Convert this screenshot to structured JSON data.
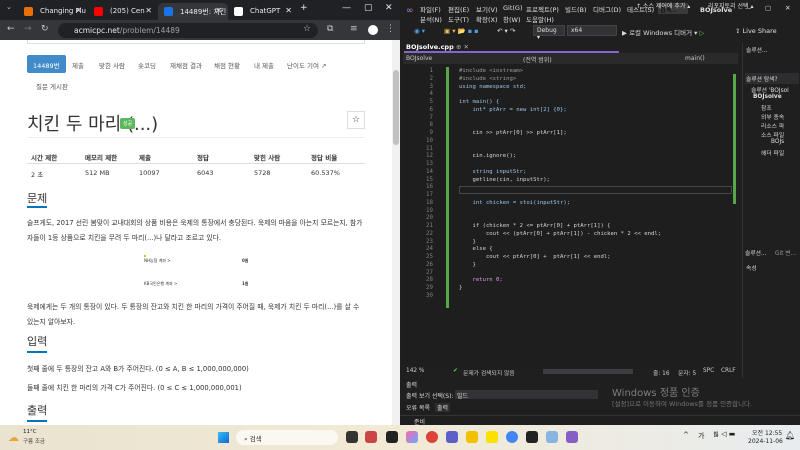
{
  "chrome": {
    "tabs": [
      {
        "label": "Changing Flu",
        "color": "#e8710a"
      },
      {
        "label": "(205) Cen",
        "color": "#ff0000"
      },
      {
        "label": "14489번: 치킨",
        "color": "#1a73e8",
        "active": true
      },
      {
        "label": "ChatGPT",
        "color": "#ffffff"
      }
    ],
    "new_tab": "+",
    "url_host": "acmicpc.net",
    "url_path": "/problem/14489"
  },
  "page": {
    "tabs": [
      "14489번",
      "제출",
      "맞힌 사람",
      "숏코딩",
      "재채점 결과",
      "채점 현황",
      "내 제출",
      "난이도 기여 ↗"
    ],
    "tab_board": "질문 게시판",
    "title": "치킨 두 마리 (...)",
    "badge": "성공",
    "star": "☆",
    "table_headers": [
      "시간 제한",
      "메모리 제한",
      "제출",
      "정답",
      "맞힌 사람",
      "정답 비율"
    ],
    "table_row": [
      "2 초",
      "512 MB",
      "10097",
      "6043",
      "5728",
      "60.537%"
    ],
    "h_problem": "문제",
    "problem_p1": "슬프게도, 2017 선린 봄맞이 교내대회의 상품 비용은 욱제의 통장에서 충당된다. 욱제의 마음을 아는지 모르는지, 참가자들이 1등 상품으로 치킨을 무려 두 마리(...)나 달라고 조르고 있다.",
    "image_rows": [
      {
        "bank": "NH농협 계좌 >",
        "amount": "0원"
      },
      {
        "bank": "KB국민은행 계좌 >",
        "amount": "1원"
      }
    ],
    "problem_p2": "욱제에게는 두 개의 통장이 있다. 두 통장의 잔고와 치킨 한 마리의 가격이 주어질 때, 욱제가 치킨 두 마리(...)를 살 수 있는지 알아보자.",
    "h_input": "입력",
    "input_1": "첫째 줄에 두 통장의 잔고 A와 B가 주어진다. (0 ≤ A, B ≤ 1,000,000,000)",
    "input_2": "둘째 줄에 치킨 한 마리의 가격 C가 주어진다. (0 ≤ C ≤ 1,000,000,001)",
    "h_output": "출력"
  },
  "vs": {
    "menu1": [
      "파일(F)",
      "편집(E)",
      "보기(V)",
      "Git(G)",
      "프로젝트(P)",
      "빌드(B)",
      "디버그(D)",
      "테스트(S)"
    ],
    "menu2": [
      "분석(N)",
      "도구(T)",
      "확장(X)",
      "창(W)",
      "도움말(H)"
    ],
    "search": "검색...",
    "solution_name": "BOJsolve",
    "config": "Debug",
    "platform": "x64",
    "run": "▶ 로컬 Windows 디버거 ▾",
    "live_share": "Live Share",
    "doc_tab": "BOJsolve.cpp",
    "nav_project": "BOJsolve",
    "nav_scope": "(전역 범위)",
    "nav_member": "main()",
    "code": [
      "#include <iostream>",
      "#include <string>",
      "using namespace std;",
      "",
      "int main() {",
      "    int* ptArr = new int[2] {0};",
      "",
      "",
      "    cin >> ptArr[0] >> ptArr[1];",
      "",
      "",
      "    cin.ignore();",
      "",
      "    string inputStr;",
      "    getline(cin, inputStr);",
      "",
      "",
      "    int chicken = stoi(inputStr);",
      "",
      "",
      "    if (chicken * 2 <= ptArr[0] + ptArr[1]) {",
      "        cout << (ptArr[0] + ptArr[1]) - chicken * 2 << endl;",
      "    }",
      "    else {",
      "        cout << ptArr[0] +  ptArr[1] << endl;",
      "    }",
      "",
      "    return 0;",
      "}",
      ""
    ],
    "zoom": "142 %",
    "issues": "문제가 검색되지 않음",
    "line": "줄: 16",
    "col": "문자: 5",
    "spc": "SPC",
    "crlf": "CRLF",
    "solution_explorer": {
      "title": "솔루션...",
      "search": "솔루션 탐색?",
      "items": [
        "솔루션 'BOJsol",
        "BOJsolve",
        "참조",
        "외부 종속",
        "리소스 파",
        "소스 파일",
        "BOJs",
        "헤더 파일"
      ],
      "tabs": [
        "솔루션...",
        "Git 변..."
      ],
      "properties": "속성"
    },
    "output": {
      "title": "출력",
      "label": "출력 보기 선택(S):",
      "value": "빌드",
      "tabs": [
        "오류 목록",
        "출력"
      ]
    },
    "status": {
      "ready": "준비",
      "source_control": "↑ 소스 제어에 추가 ▴",
      "repo": "리포지토리 선택 ▴"
    },
    "watermark": "Windows 정품 인증",
    "watermark_sub": "[설정]으로 이동하여 Windows를 정품 인증합니다."
  },
  "taskbar": {
    "temp": "11°C",
    "weather": "구름 조금",
    "search": "검색",
    "time": "오전 12:55",
    "date": "2024-11-06",
    "ime": "가"
  }
}
